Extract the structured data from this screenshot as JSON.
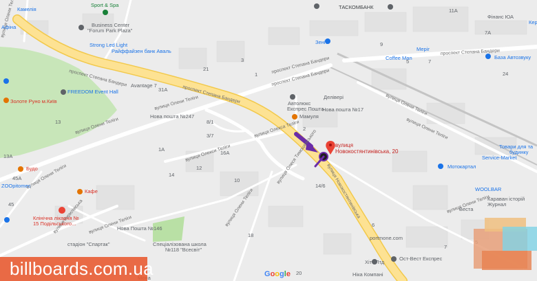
{
  "map": {
    "roads_major": [
      "проспект Степана Бандери",
      "проспект Степана Бандери",
      "проспект Степана Бандери",
      "вулиця Новокостянтинівська"
    ],
    "streets": [
      "вулиця Олени Теліги",
      "вулиця Олени Теліги",
      "вулиця Олени Теліги",
      "вулиця Олекса Теліги",
      "вулиця Олекси Теліги",
      "вулиця Олени Теліги",
      "вулиця Олекса Теліги",
      "проспект Степана Бандери",
      "проспект Степана Бандери",
      "вулиця Олеся Тимошевського",
      "вулиця Олени Теліги",
      "вулиця Кирилівська",
      "вулиця Олени Теліги",
      "вулиця Олени Теліги",
      "вулиця Олени Теліги",
      "вулиця Олени Теліги",
      "вулиця Олени Теліги"
    ],
    "street_dorohozhytska": "вулиця Олени Теліги",
    "pois": {
      "kameliia": "Камелія",
      "sport_spa": "Sport & Spa",
      "afina": "Афіна",
      "business_center_1": "Business Center",
      "business_center_2": "\"Forum Park Plaza\"",
      "strong_led": "Strong Led Light",
      "raiffeisen": "Райффайзен банк Аваль",
      "avantage": "Avantage 7",
      "freedom": "FREEDOM Event Hall",
      "zoloto": "Золоте Руно м.Київ",
      "nova_poshta_247": "Нова пошта №247",
      "avtolyuks_1": "Автолюкс",
      "avtolyuks_2": "Експрес Пошта",
      "delivery": "Делівері",
      "nova_poshta_17": "Нова пошта №17",
      "mamulia": "Мамуля",
      "tascombank": "ТАСКОМБАНК",
      "zenit": "Зеніт",
      "finans_yua": "Фінанс ЮА",
      "kerov": "Кер",
      "coffee_man": "Coffee Man",
      "meridian": "Меріг",
      "baza_avtozvuku": "База Автозвуку",
      "budo": "Будо",
      "zoopitomets": "ZOOpitomec",
      "kafe": "Кафе",
      "likarnia_1": "Клінічна лікарня №",
      "likarnia_2": "15 Подільського...",
      "stadion": "стадіон \"Спартак\"",
      "nova_poshta_146": "Нова Пошта №146",
      "school_1": "Спеціалізована школа",
      "school_2": "№118 \"Всесвіт\"",
      "motokartal": "Мотокартал",
      "woolbar": "WOOLBAR",
      "karavan_1": "Караван історій",
      "karavan_2": "Журнал",
      "service_market": "Service-Market",
      "tovary_1": "Товари для та",
      "tovary_2": "будинку",
      "vesta": "Веста",
      "ost_vest": "Ост-Вест Експрес",
      "portmone": "portmone.com",
      "hitt": "Хітт Лтд",
      "nika": "Ніка Компані",
      "mona": "Мона"
    },
    "pin_label_1": "вулиця",
    "pin_label_2": "Новокостянтинівська, 20",
    "house_numbers": [
      "11А",
      "9",
      "7",
      "7А",
      "5",
      "3",
      "21",
      "31А",
      "14/6",
      "1",
      "2",
      "3/7",
      "12",
      "16А",
      "10",
      "14",
      "1А",
      "13",
      "13А",
      "20",
      "24",
      "5",
      "7",
      "45",
      "45А",
      "6",
      "18",
      "8/1"
    ]
  },
  "branding": {
    "watermark": "billboards.com.ua",
    "google_logo": [
      "G",
      "o",
      "o",
      "g",
      "l",
      "e"
    ]
  },
  "colors": {
    "background": "#ececec",
    "park": "#c8e6b9",
    "building": "#e3e3e3",
    "minor_road": "#ffffff",
    "major_road": "#fde293",
    "major_road_edge": "#f2c94c",
    "rail": "#c4c4c4",
    "arrow": "#6a2ca8",
    "pin": "#ea4335",
    "watermark_bg": "#e8582e"
  }
}
